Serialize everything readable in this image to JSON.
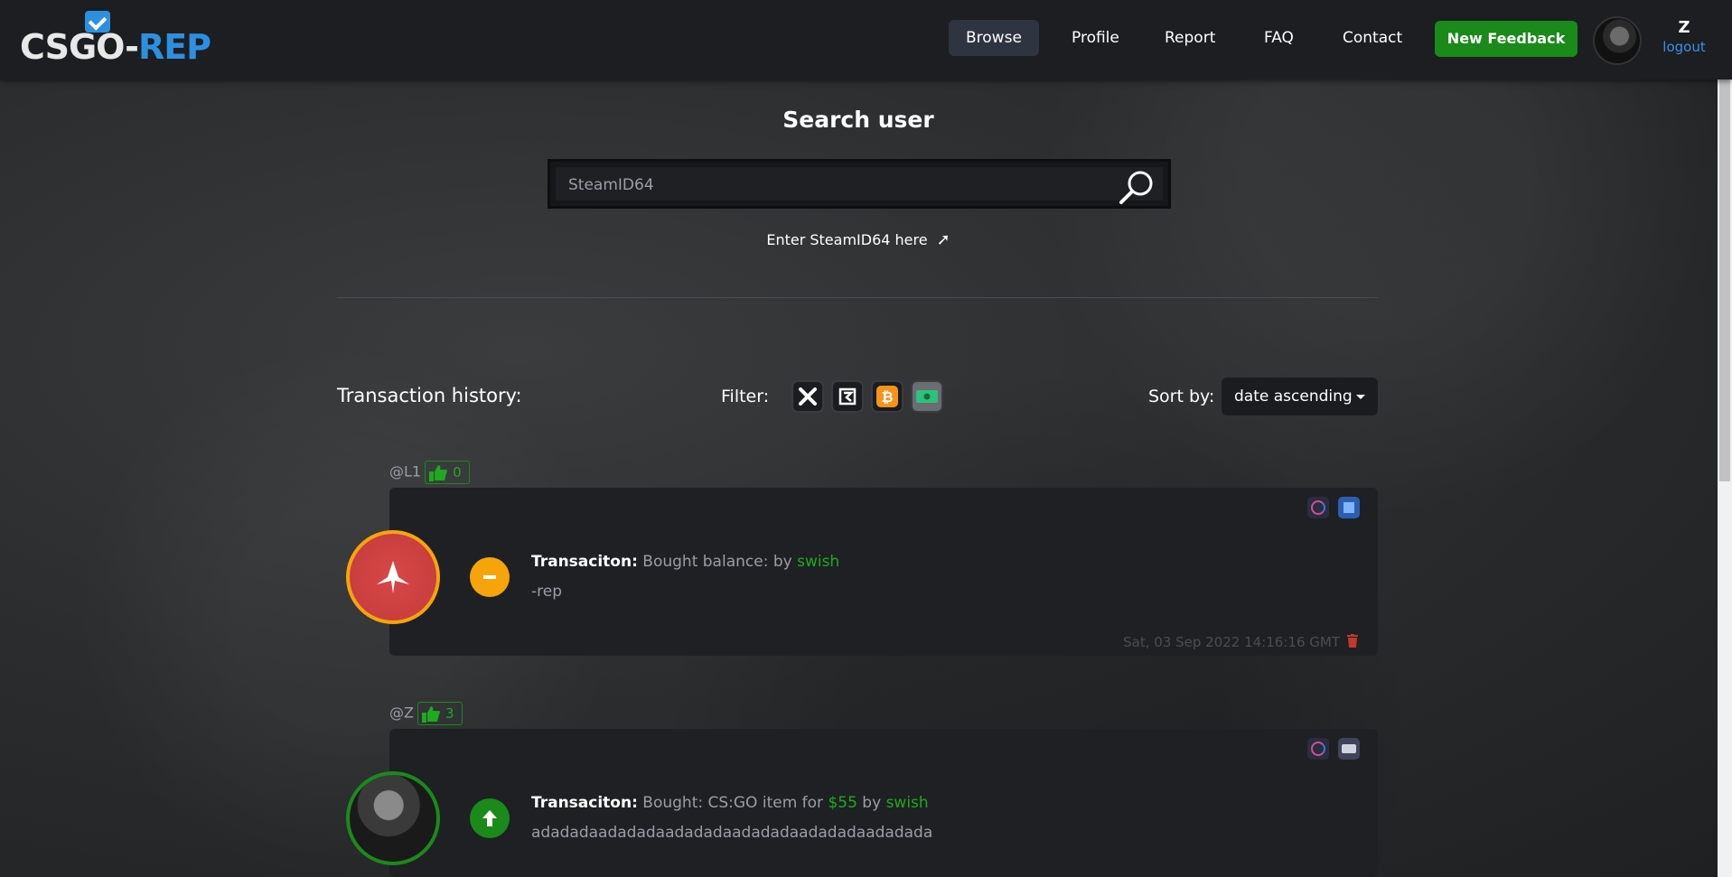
{
  "brand": {
    "logo_part1": "CSGO-",
    "logo_part2": "REP"
  },
  "nav": {
    "links": [
      "Browse",
      "Profile",
      "Report",
      "FAQ",
      "Contact"
    ],
    "active": "Browse",
    "new_feedback": "New Feedback",
    "username": "Z",
    "logout": "logout"
  },
  "search": {
    "title": "Search user",
    "placeholder": "SteamID64",
    "hint": "Enter SteamID64 here"
  },
  "history": {
    "label": "Transaction history:",
    "filter_label": "Filter:",
    "filters": [
      {
        "icon": "close-icon",
        "color": "#ffffff"
      },
      {
        "icon": "skinport-icon",
        "color": "#ffffff"
      },
      {
        "icon": "bitcoin-icon",
        "color": "#f7931a"
      },
      {
        "icon": "cash-icon",
        "color": "#2ec27e"
      }
    ],
    "sort_label": "Sort by:",
    "sort_value": "date ascending"
  },
  "feedbacks": [
    {
      "user": "@L1",
      "rep": "0",
      "transaction_label": "Transaciton:",
      "transaction_text": "Bought balance: by",
      "amount": "",
      "by": "swish",
      "comment": "-rep",
      "date": "Sat, 03 Sep 2022 14:16:16 GMT",
      "vote": "negative",
      "vote_color": "#f5a50a"
    },
    {
      "user": "@Z",
      "rep": "3",
      "transaction_label": "Transaciton:",
      "transaction_text": "Bought: CS:GO item for",
      "amount": "$55",
      "by_prefix": "by",
      "by": "swish",
      "comment": "adadadaadadadaadadadaadadadaadadadaadadada",
      "vote": "positive",
      "vote_color": "#1a8a1a"
    }
  ]
}
